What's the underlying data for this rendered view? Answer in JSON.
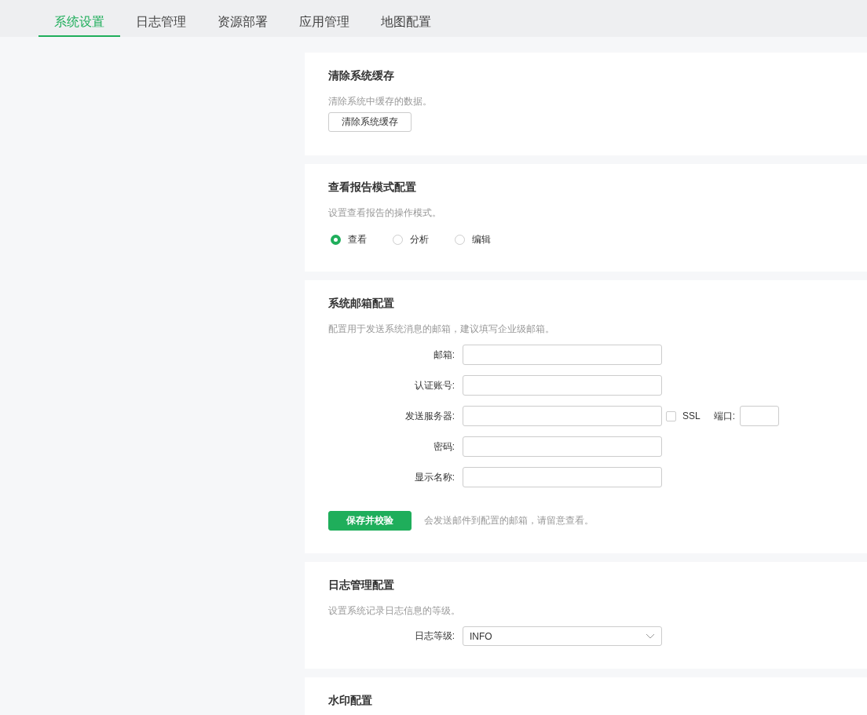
{
  "tabs": [
    {
      "label": "系统设置",
      "selected": true
    },
    {
      "label": "日志管理",
      "selected": false
    },
    {
      "label": "资源部署",
      "selected": false
    },
    {
      "label": "应用管理",
      "selected": false
    },
    {
      "label": "地图配置",
      "selected": false
    }
  ],
  "sections": [
    {
      "kind": "button",
      "title": "清除系统缓存",
      "description": "清除系统中缓存的数据。",
      "button": "清除系统缓存"
    },
    {
      "kind": "radio",
      "title": "查看报告模式配置",
      "description": "设置查看报告的操作模式。",
      "options": [
        {
          "label": "查看",
          "selected": true
        },
        {
          "label": "分析",
          "selected": false
        },
        {
          "label": "编辑",
          "selected": false
        }
      ]
    },
    {
      "kind": "form",
      "title": "系统邮箱配置",
      "description": "配置用于发送系统消息的邮箱，建议填写企业级邮箱。",
      "fields": [
        {
          "label": "邮箱:",
          "kind": "text"
        },
        {
          "label": "认证账号:",
          "kind": "text"
        },
        {
          "label": "发送服务器:",
          "kind": "server",
          "ssl": {
            "label": "SSL",
            "checked": false
          },
          "port_label": "端口:"
        },
        {
          "label": "密码:",
          "kind": "text"
        },
        {
          "label": "显示名称:",
          "kind": "text"
        }
      ],
      "button": "保存并校验",
      "note": "会发送邮件到配置的邮箱，请留意查看。"
    },
    {
      "kind": "select",
      "title": "日志管理配置",
      "description": "设置系统记录日志信息的等级。",
      "label": "日志等级:",
      "value": "INFO"
    },
    {
      "kind": "title",
      "title": "水印配置"
    }
  ]
}
